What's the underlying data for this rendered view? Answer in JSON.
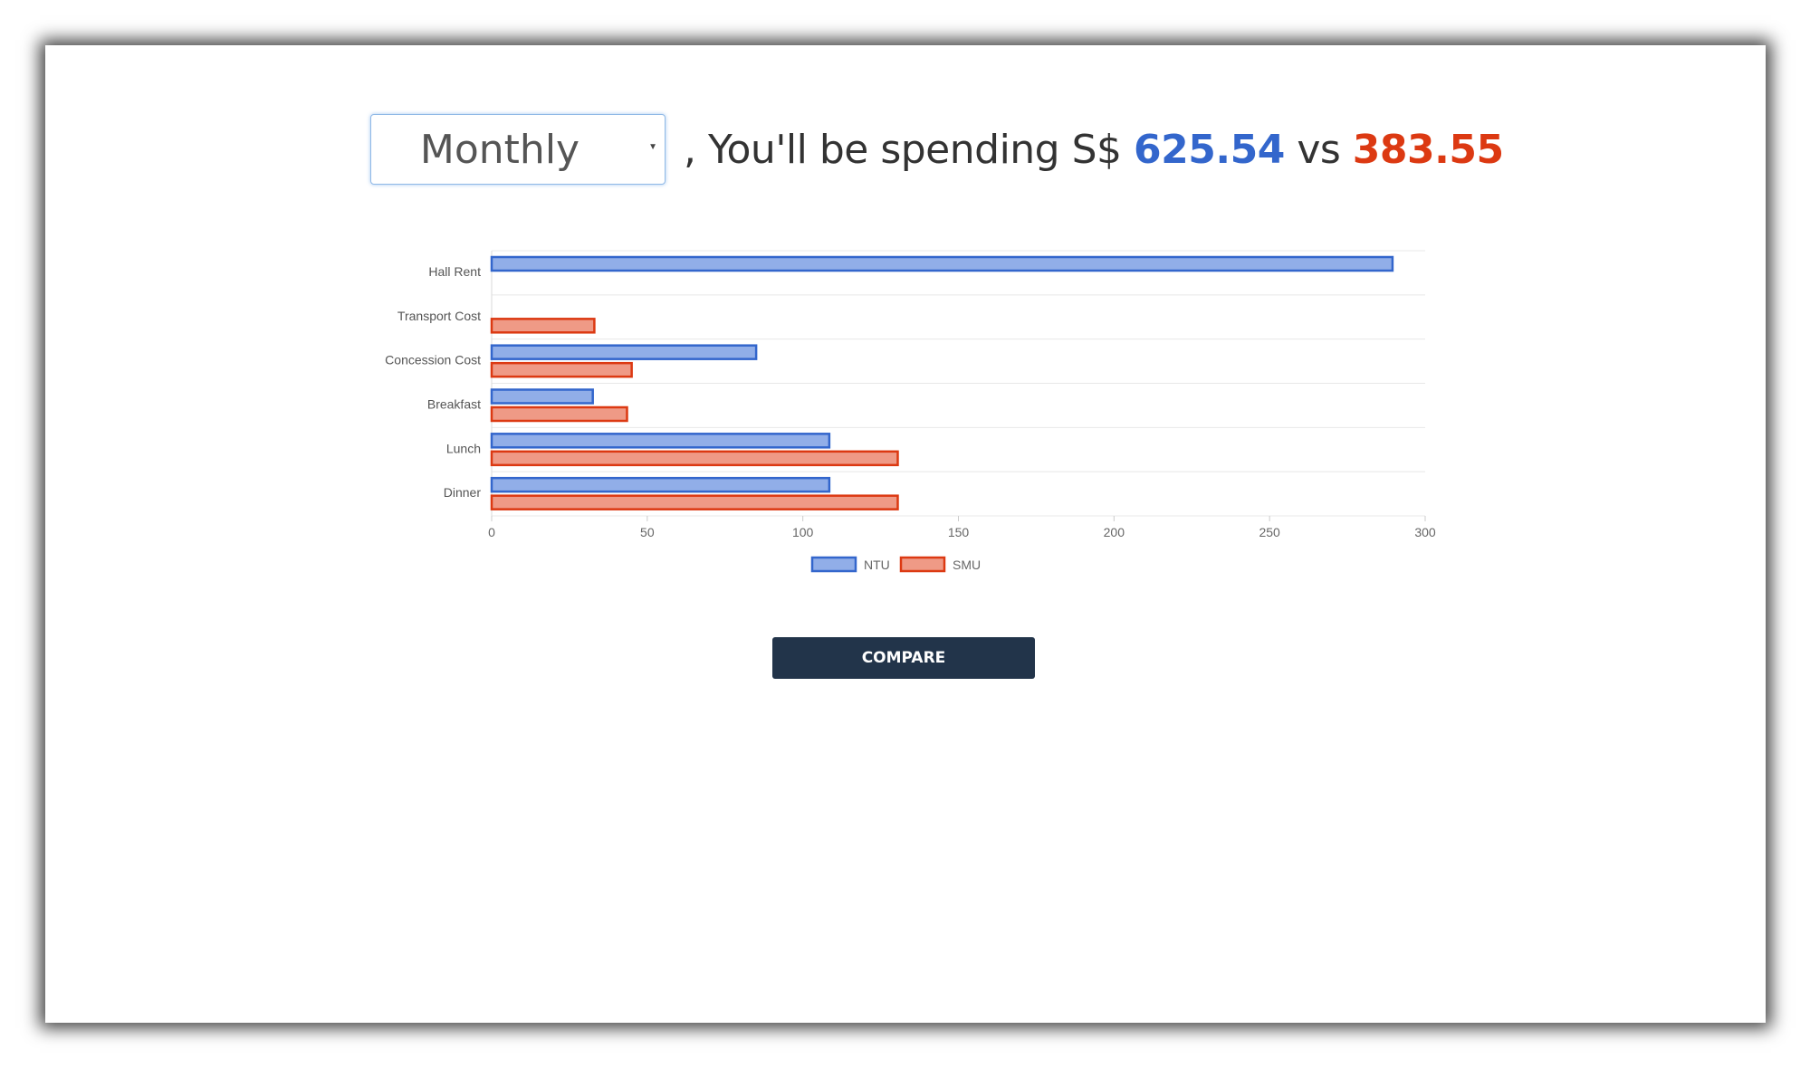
{
  "period_select": {
    "value": "Monthly"
  },
  "headline": {
    "prefix": ", You'll be spending S$",
    "amount_a": "625.54",
    "separator": "vs",
    "amount_b": "383.55"
  },
  "colors": {
    "ntu_fill": "#91aee8",
    "ntu_stroke": "#3366cc",
    "smu_fill": "#ef9a86",
    "smu_stroke": "#dc3912",
    "amount_a": "#3366cc",
    "amount_b": "#dc3912",
    "button_bg": "#22344a"
  },
  "chart_data": {
    "type": "bar",
    "orientation": "horizontal",
    "categories": [
      "Hall Rent",
      "Transport Cost",
      "Concession Cost",
      "Breakfast",
      "Lunch",
      "Dinner"
    ],
    "series": [
      {
        "name": "NTU",
        "values": [
          289.5,
          0,
          85,
          32.5,
          108.5,
          108.5
        ]
      },
      {
        "name": "SMU",
        "values": [
          0,
          33,
          45,
          43.5,
          130.5,
          130.5
        ]
      }
    ],
    "xlim": [
      0,
      300
    ],
    "xticks": [
      0,
      50,
      100,
      150,
      200,
      250,
      300
    ],
    "grid": true,
    "legend": "bottom"
  },
  "buttons": {
    "compare": "COMPARE"
  }
}
